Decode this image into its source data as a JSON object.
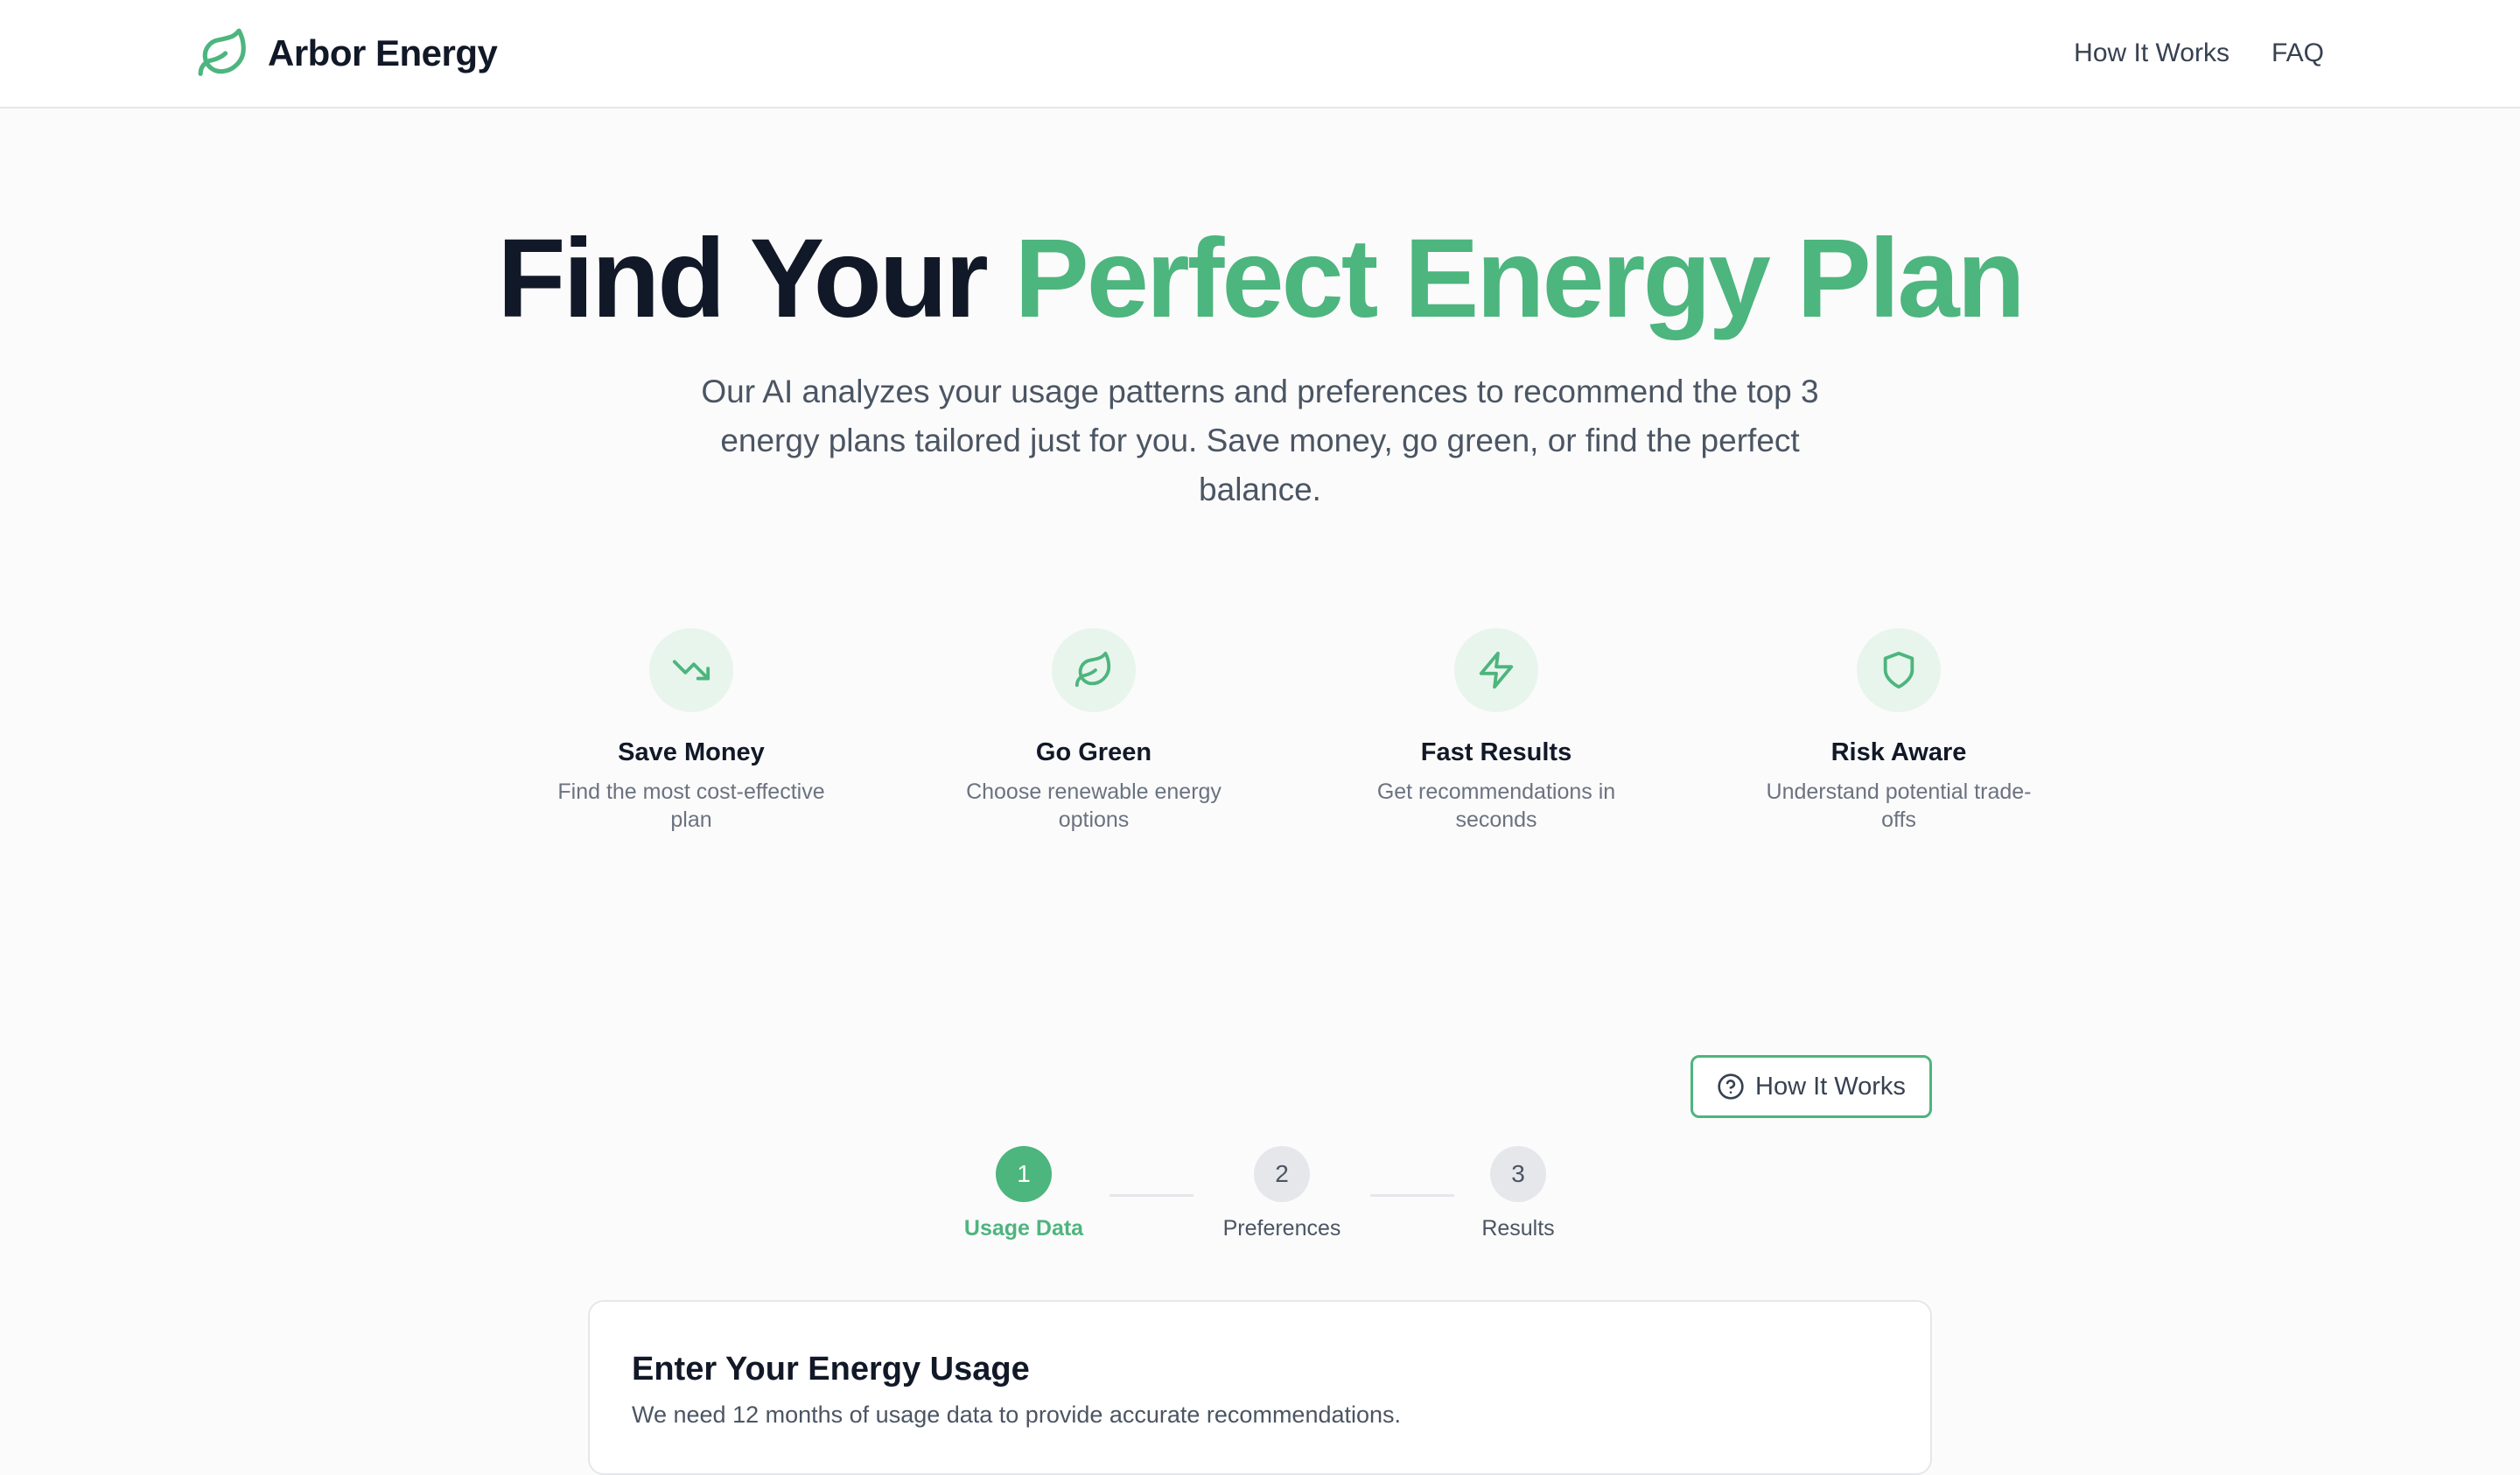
{
  "brand": {
    "name": "Arbor Energy",
    "logo_icon": "leaf-icon",
    "accent": "#4db57e"
  },
  "nav": {
    "items": [
      "How It Works",
      "FAQ"
    ]
  },
  "hero": {
    "title_dark": "Find Your ",
    "title_accent": "Perfect Energy Plan",
    "subtitle": "Our AI analyzes your usage patterns and preferences to recommend the top 3 energy plans tailored just for you. Save money, go green, or find the perfect balance."
  },
  "features": [
    {
      "icon": "trending-down-icon",
      "title": "Save Money",
      "desc": "Find the most cost-effective plan"
    },
    {
      "icon": "leaf-icon",
      "title": "Go Green",
      "desc": "Choose renewable energy options"
    },
    {
      "icon": "lightning-icon",
      "title": "Fast Results",
      "desc": "Get recommendations in seconds"
    },
    {
      "icon": "shield-icon",
      "title": "Risk Aware",
      "desc": "Understand potential trade-offs"
    }
  ],
  "how_it_works_button": {
    "label": "How It Works",
    "icon": "help-circle-icon"
  },
  "steps": [
    {
      "number": "1",
      "label": "Usage Data",
      "active": true
    },
    {
      "number": "2",
      "label": "Preferences",
      "active": false
    },
    {
      "number": "3",
      "label": "Results",
      "active": false
    }
  ],
  "card": {
    "title": "Enter Your Energy Usage",
    "description": "We need 12 months of usage data to provide accurate recommendations."
  }
}
